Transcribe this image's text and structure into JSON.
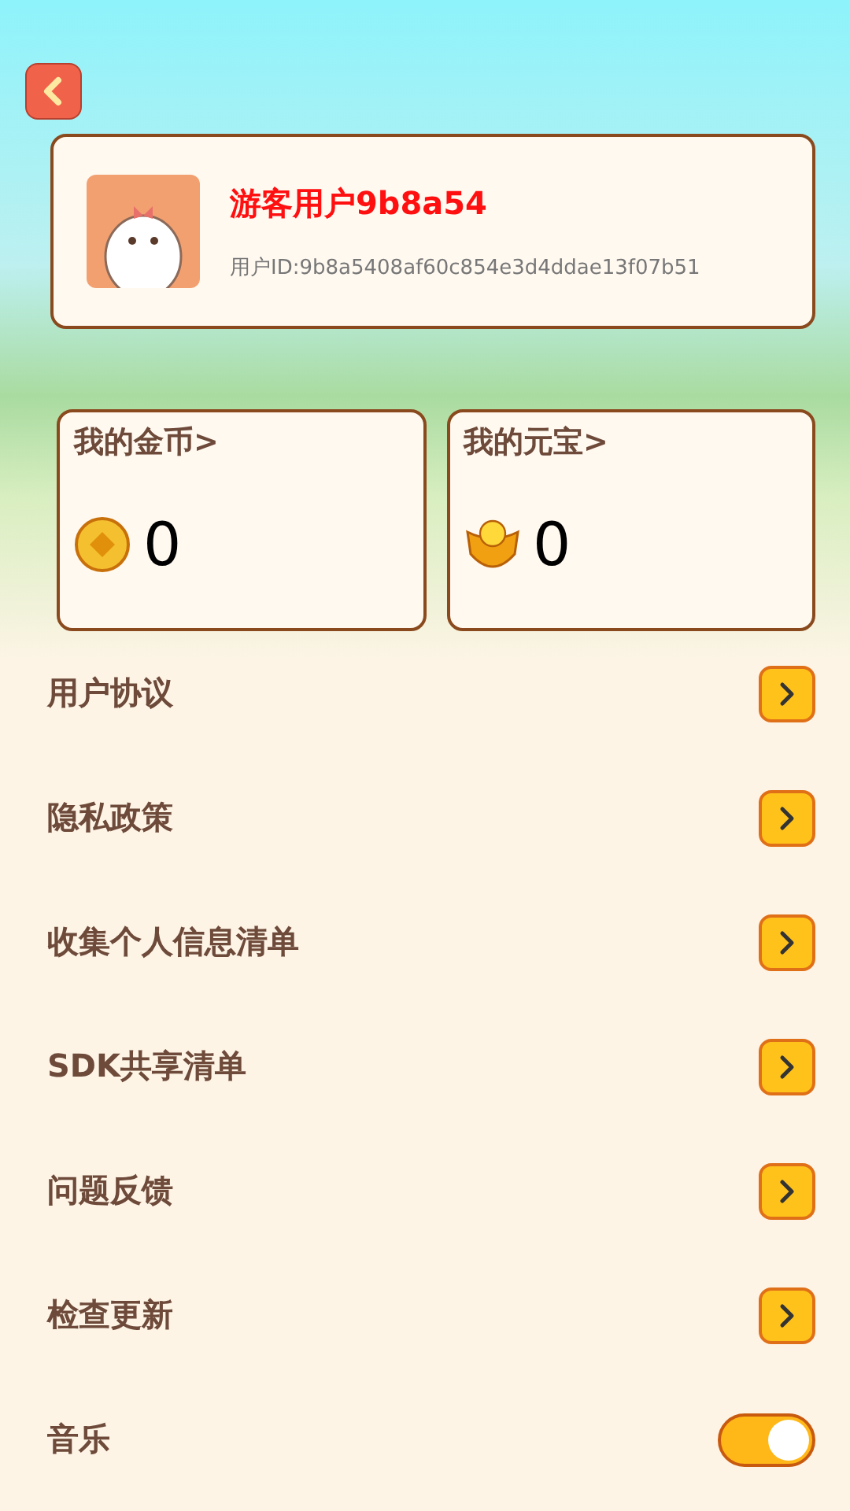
{
  "profile": {
    "name": "游客用户9b8a54",
    "user_id": "用户ID:9b8a5408af60c854e3d4ddae13f07b51"
  },
  "wallet": [
    {
      "kind": "coin",
      "label": "我的金币>",
      "amount": "0"
    },
    {
      "kind": "ingot",
      "label": "我的元宝>",
      "amount": "0"
    }
  ],
  "settings": [
    {
      "kind": "link",
      "label": "用户协议"
    },
    {
      "kind": "link",
      "label": "隐私政策"
    },
    {
      "kind": "link",
      "label": "收集个人信息清单"
    },
    {
      "kind": "link",
      "label": "SDK共享清单"
    },
    {
      "kind": "link",
      "label": "问题反馈"
    },
    {
      "kind": "link",
      "label": "检查更新"
    },
    {
      "kind": "toggle",
      "label": "音乐",
      "on": true
    }
  ]
}
